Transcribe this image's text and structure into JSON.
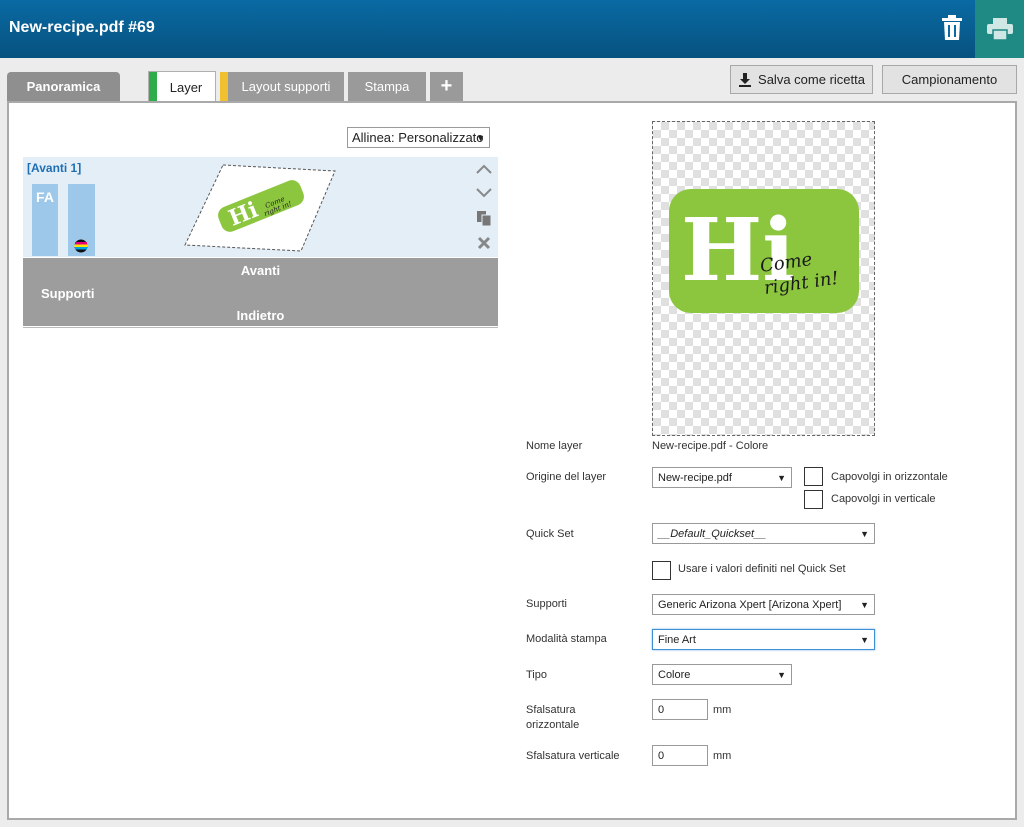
{
  "header": {
    "title": "New-recipe.pdf #69",
    "trash_icon": "trash-icon",
    "print_icon": "printer-icon"
  },
  "tabs": {
    "panoramica": "Panoramica",
    "layer": "Layer",
    "layout": "Layout supporti",
    "stampa": "Stampa",
    "add": "+"
  },
  "actions": {
    "save": "Salva come ricetta",
    "sampling": "Campionamento"
  },
  "align": {
    "value": "Allinea: Personalizzato"
  },
  "layer_card": {
    "name": "[Avanti 1]",
    "fa_label": "FA",
    "logo_text": "Hi"
  },
  "supports": {
    "front": "Avanti",
    "label": "Supporti",
    "back": "Indietro"
  },
  "preview": {
    "logo_big": "Hi",
    "logo_script_1": "Come",
    "logo_script_2": "right in!"
  },
  "form": {
    "name_label": "Nome layer",
    "name_value": "New-recipe.pdf - Colore",
    "origin_label": "Origine del layer",
    "origin_value": "New-recipe.pdf",
    "flip_h": "Capovolgi in orizzontale",
    "flip_v": "Capovolgi in verticale",
    "quickset_label": "Quick Set",
    "quickset_value": "__Default_Quickset__",
    "use_quickset": "Usare i valori definiti nel Quick Set",
    "media_label": "Supporti",
    "media_value": "Generic Arizona Xpert [Arizona Xpert]",
    "mode_label": "Modalità stampa",
    "mode_value": "Fine Art",
    "type_label": "Tipo",
    "type_value": "Colore",
    "offset_h_label_1": "Sfalsatura",
    "offset_h_label_2": "orizzontale",
    "offset_h_value": "0",
    "offset_v_label": "Sfalsatura verticale",
    "offset_v_value": "0",
    "unit": "mm"
  },
  "colors": {
    "header": "#0a6aa3",
    "print_button": "#1f8a83",
    "layer_tab_accent": "#2fad4a",
    "layout_tab_accent": "#f0c030",
    "logo_green": "#8cc63f"
  }
}
